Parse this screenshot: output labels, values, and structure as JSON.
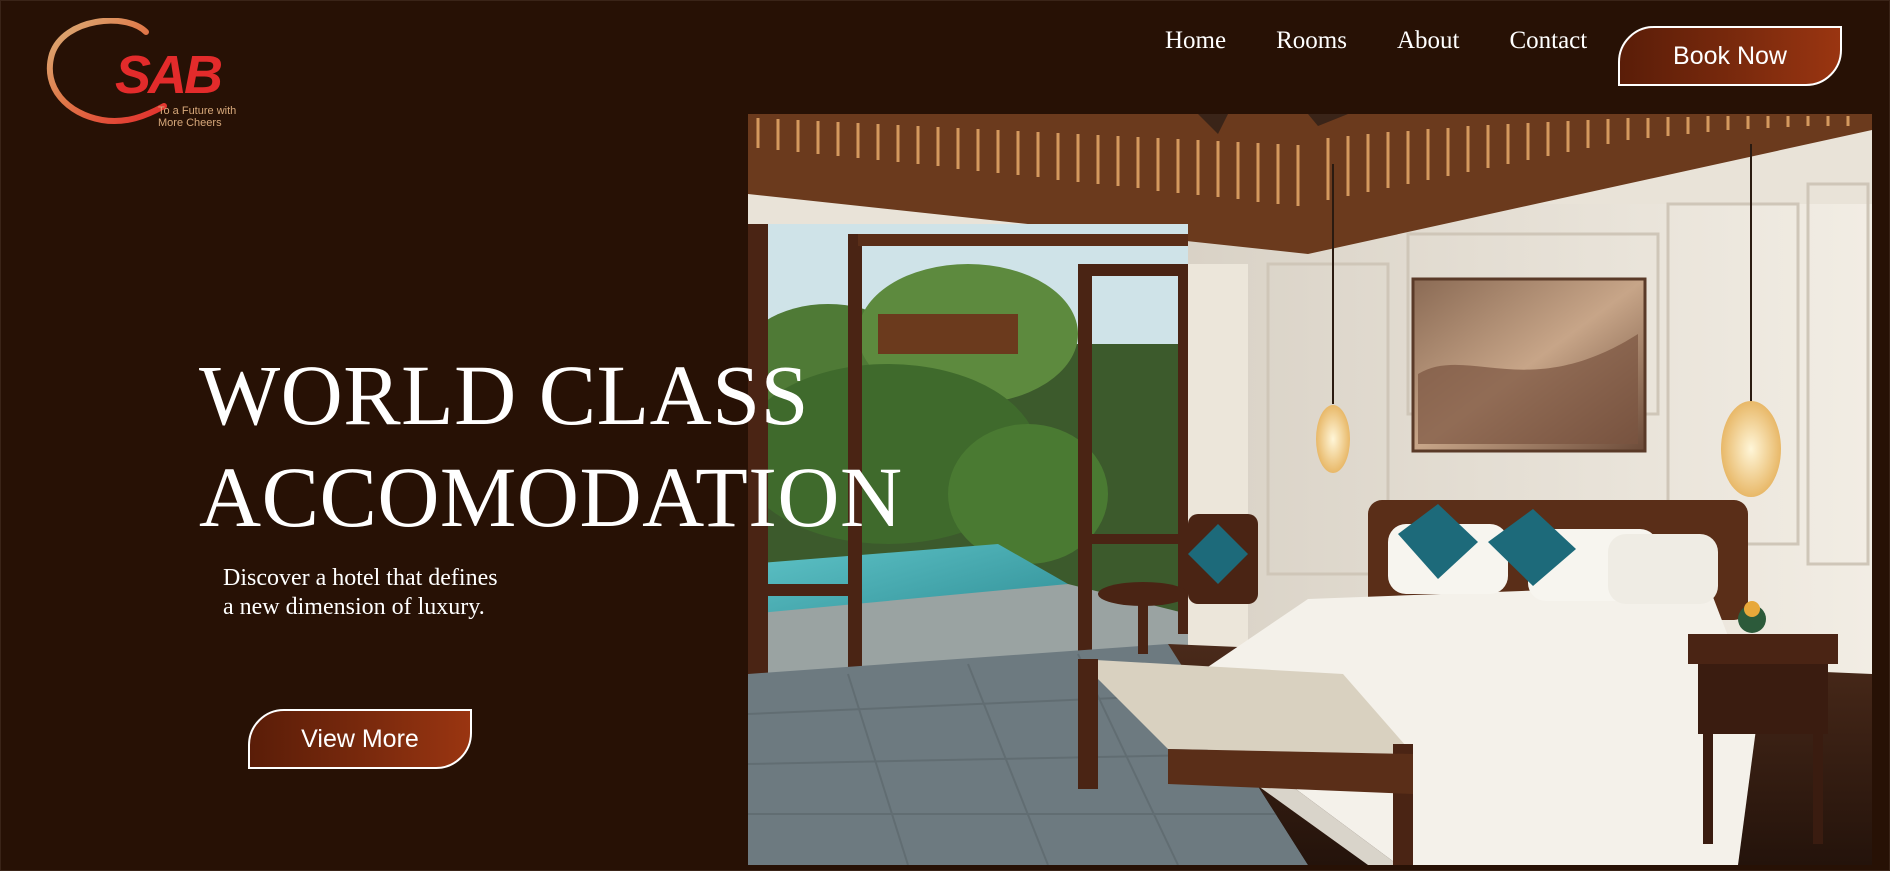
{
  "brand": {
    "logo_text": "SAB",
    "tagline": "To a Future with\nMore Cheers",
    "colors": {
      "logo_red": "#e32b2b",
      "logo_gold": "#d7a87a"
    }
  },
  "nav": {
    "items": [
      "Home",
      "Rooms",
      "About",
      "Contact"
    ],
    "cta": "Book Now"
  },
  "hero": {
    "title_lines": [
      "WORLD CLASS",
      "ACCOMODATION"
    ],
    "subtitle_lines": [
      "Discover a hotel that defines",
      "a new dimension of luxury."
    ],
    "cta": "View More",
    "image": "luxury-hotel-bedroom-photo"
  },
  "theme": {
    "background": "#271105",
    "button_gradient": [
      "#5a1d08",
      "#9a3511"
    ],
    "text": "#ffffff"
  }
}
